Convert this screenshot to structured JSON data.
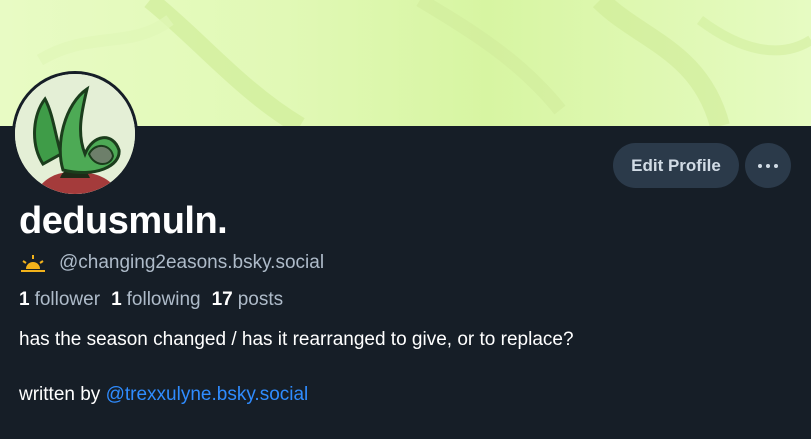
{
  "profile": {
    "display_name": "dedusmuln.",
    "handle": "@changing2easons.bsky.social",
    "followers_count": "1",
    "followers_label": "follower",
    "following_count": "1",
    "following_label": "following",
    "posts_count": "17",
    "posts_label": "posts",
    "bio_line1": "has the season changed / has it rearranged to give, or to replace?",
    "bio_prefix": "written by",
    "bio_mention": "@trexxulyne.bsky.social"
  },
  "actions": {
    "edit_profile_label": "Edit Profile"
  },
  "colors": {
    "background": "#161e27",
    "button_bg": "#2b3a4a",
    "link": "#2f8cff",
    "banner": "#e1f9b6"
  },
  "icons": {
    "status": "sun-icon",
    "more": "more-horizontal-icon"
  }
}
